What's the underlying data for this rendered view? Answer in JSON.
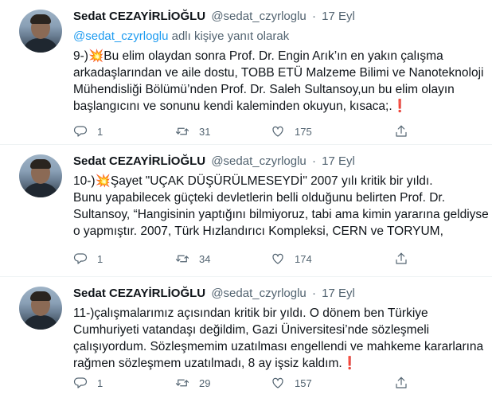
{
  "tweets": [
    {
      "author": "Sedat CEZAYİRLİOĞLU",
      "handle": "@sedat_czyrloglu",
      "sep": "·",
      "date": "17 Eyl",
      "reply_mention": "@sedat_czyrloglu",
      "reply_suffix": " adlı kişiye yanıt olarak",
      "lines": [
        "9-)💥Bu elim olaydan sonra Prof. Dr. Engin Arık’ın en yakın çalışma",
        "arkadaşlarından ve aile dostu, TOBB ETÜ Malzeme Bilimi ve Nanoteknoloji",
        "Mühendisliği Bölümü’nden Prof. Dr. Saleh Sultansoy,un bu elim olayın",
        "başlangıcını ve sonunu kendi kaleminden okuyun, kısaca;.❗"
      ],
      "replies": "1",
      "retweets": "31",
      "likes": "175"
    },
    {
      "author": "Sedat CEZAYİRLİOĞLU",
      "handle": "@sedat_czyrloglu",
      "sep": "·",
      "date": "17 Eyl",
      "lines": [
        "10-)💥Şayet \"UÇAK DÜŞÜRÜLMESEYDİ\" 2007 yılı kritik bir yıldı.",
        "Bunu yapabilecek güçteki devletlerin belli olduğunu belirten Prof. Dr.",
        "Sultansoy, “Hangisinin yaptığını bilmiyoruz, tabi ama kimin yararına geldiyse",
        "o yapmıştır. 2007, Türk Hızlandırıcı Kompleksi, CERN ve TORYUM,"
      ],
      "replies": "1",
      "retweets": "34",
      "likes": "174"
    },
    {
      "author": "Sedat CEZAYİRLİOĞLU",
      "handle": "@sedat_czyrloglu",
      "sep": "·",
      "date": "17 Eyl",
      "lines": [
        "11-)çalışmalarımız açısından kritik bir yıldı. O dönem ben Türkiye",
        "Cumhuriyeti vatandaşı değildim, Gazi Üniversitesi’nde sözleşmeli",
        "çalışıyordum. Sözleşmemim uzatılması engellendi ve mahkeme kararlarına",
        "rağmen sözleşmem uzatılmadı, 8 ay işsiz kaldım.❗"
      ],
      "replies": "1",
      "retweets": "29",
      "likes": "157"
    }
  ],
  "icons": {
    "reply": "reply-icon",
    "retweet": "retweet-icon",
    "like": "heart-icon",
    "share": "share-icon"
  }
}
